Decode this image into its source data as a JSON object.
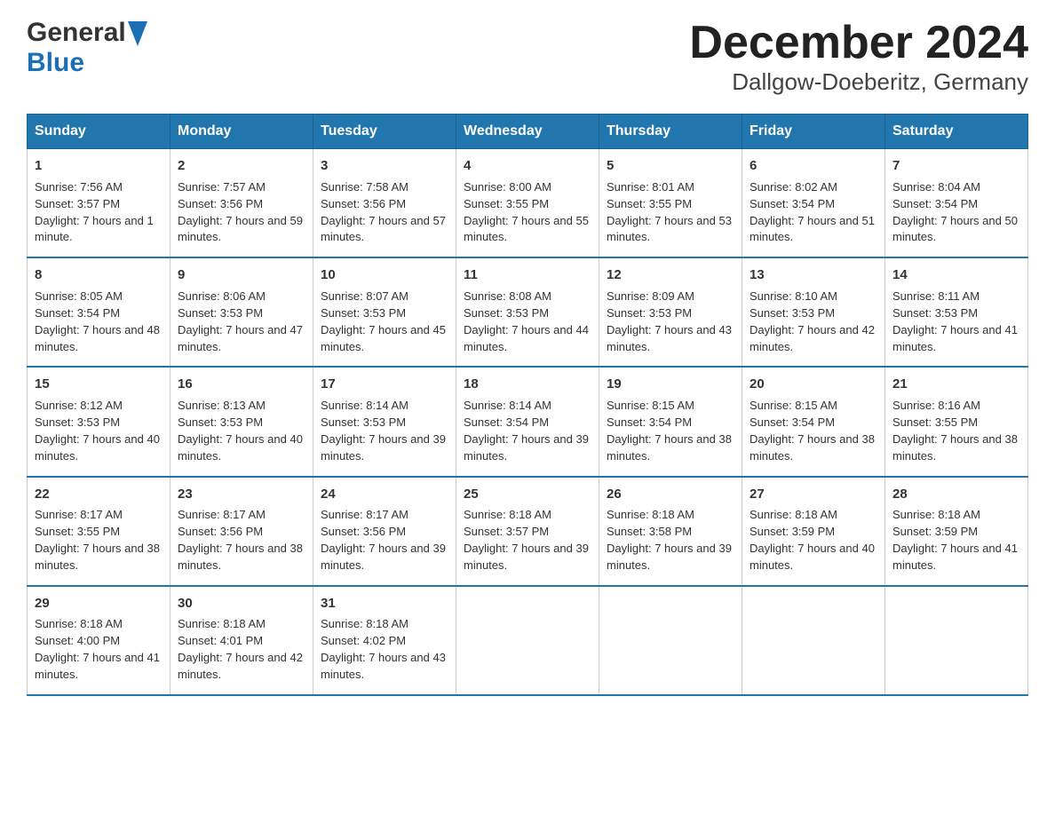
{
  "header": {
    "logo_general": "General",
    "logo_blue": "Blue",
    "title": "December 2024",
    "subtitle": "Dallgow-Doeberitz, Germany"
  },
  "columns": [
    "Sunday",
    "Monday",
    "Tuesday",
    "Wednesday",
    "Thursday",
    "Friday",
    "Saturday"
  ],
  "weeks": [
    [
      {
        "day": "1",
        "sunrise": "7:56 AM",
        "sunset": "3:57 PM",
        "daylight": "7 hours and 1 minute."
      },
      {
        "day": "2",
        "sunrise": "7:57 AM",
        "sunset": "3:56 PM",
        "daylight": "7 hours and 59 minutes."
      },
      {
        "day": "3",
        "sunrise": "7:58 AM",
        "sunset": "3:56 PM",
        "daylight": "7 hours and 57 minutes."
      },
      {
        "day": "4",
        "sunrise": "8:00 AM",
        "sunset": "3:55 PM",
        "daylight": "7 hours and 55 minutes."
      },
      {
        "day": "5",
        "sunrise": "8:01 AM",
        "sunset": "3:55 PM",
        "daylight": "7 hours and 53 minutes."
      },
      {
        "day": "6",
        "sunrise": "8:02 AM",
        "sunset": "3:54 PM",
        "daylight": "7 hours and 51 minutes."
      },
      {
        "day": "7",
        "sunrise": "8:04 AM",
        "sunset": "3:54 PM",
        "daylight": "7 hours and 50 minutes."
      }
    ],
    [
      {
        "day": "8",
        "sunrise": "8:05 AM",
        "sunset": "3:54 PM",
        "daylight": "7 hours and 48 minutes."
      },
      {
        "day": "9",
        "sunrise": "8:06 AM",
        "sunset": "3:53 PM",
        "daylight": "7 hours and 47 minutes."
      },
      {
        "day": "10",
        "sunrise": "8:07 AM",
        "sunset": "3:53 PM",
        "daylight": "7 hours and 45 minutes."
      },
      {
        "day": "11",
        "sunrise": "8:08 AM",
        "sunset": "3:53 PM",
        "daylight": "7 hours and 44 minutes."
      },
      {
        "day": "12",
        "sunrise": "8:09 AM",
        "sunset": "3:53 PM",
        "daylight": "7 hours and 43 minutes."
      },
      {
        "day": "13",
        "sunrise": "8:10 AM",
        "sunset": "3:53 PM",
        "daylight": "7 hours and 42 minutes."
      },
      {
        "day": "14",
        "sunrise": "8:11 AM",
        "sunset": "3:53 PM",
        "daylight": "7 hours and 41 minutes."
      }
    ],
    [
      {
        "day": "15",
        "sunrise": "8:12 AM",
        "sunset": "3:53 PM",
        "daylight": "7 hours and 40 minutes."
      },
      {
        "day": "16",
        "sunrise": "8:13 AM",
        "sunset": "3:53 PM",
        "daylight": "7 hours and 40 minutes."
      },
      {
        "day": "17",
        "sunrise": "8:14 AM",
        "sunset": "3:53 PM",
        "daylight": "7 hours and 39 minutes."
      },
      {
        "day": "18",
        "sunrise": "8:14 AM",
        "sunset": "3:54 PM",
        "daylight": "7 hours and 39 minutes."
      },
      {
        "day": "19",
        "sunrise": "8:15 AM",
        "sunset": "3:54 PM",
        "daylight": "7 hours and 38 minutes."
      },
      {
        "day": "20",
        "sunrise": "8:15 AM",
        "sunset": "3:54 PM",
        "daylight": "7 hours and 38 minutes."
      },
      {
        "day": "21",
        "sunrise": "8:16 AM",
        "sunset": "3:55 PM",
        "daylight": "7 hours and 38 minutes."
      }
    ],
    [
      {
        "day": "22",
        "sunrise": "8:17 AM",
        "sunset": "3:55 PM",
        "daylight": "7 hours and 38 minutes."
      },
      {
        "day": "23",
        "sunrise": "8:17 AM",
        "sunset": "3:56 PM",
        "daylight": "7 hours and 38 minutes."
      },
      {
        "day": "24",
        "sunrise": "8:17 AM",
        "sunset": "3:56 PM",
        "daylight": "7 hours and 39 minutes."
      },
      {
        "day": "25",
        "sunrise": "8:18 AM",
        "sunset": "3:57 PM",
        "daylight": "7 hours and 39 minutes."
      },
      {
        "day": "26",
        "sunrise": "8:18 AM",
        "sunset": "3:58 PM",
        "daylight": "7 hours and 39 minutes."
      },
      {
        "day": "27",
        "sunrise": "8:18 AM",
        "sunset": "3:59 PM",
        "daylight": "7 hours and 40 minutes."
      },
      {
        "day": "28",
        "sunrise": "8:18 AM",
        "sunset": "3:59 PM",
        "daylight": "7 hours and 41 minutes."
      }
    ],
    [
      {
        "day": "29",
        "sunrise": "8:18 AM",
        "sunset": "4:00 PM",
        "daylight": "7 hours and 41 minutes."
      },
      {
        "day": "30",
        "sunrise": "8:18 AM",
        "sunset": "4:01 PM",
        "daylight": "7 hours and 42 minutes."
      },
      {
        "day": "31",
        "sunrise": "8:18 AM",
        "sunset": "4:02 PM",
        "daylight": "7 hours and 43 minutes."
      },
      null,
      null,
      null,
      null
    ]
  ]
}
